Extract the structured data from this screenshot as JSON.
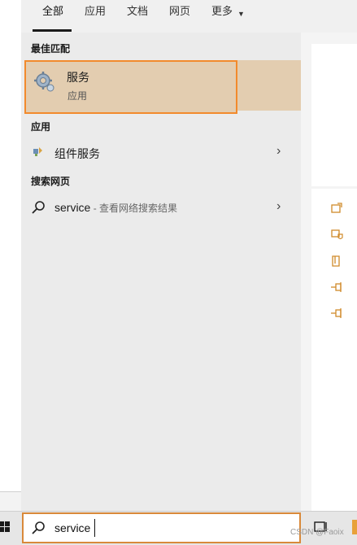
{
  "tabs": [
    {
      "label": "全部",
      "active": true
    },
    {
      "label": "应用"
    },
    {
      "label": "文档"
    },
    {
      "label": "网页"
    },
    {
      "label": "更多"
    }
  ],
  "sections": {
    "best_match": "最佳匹配",
    "apps": "应用",
    "web": "搜索网页"
  },
  "best_match_item": {
    "title": "服务",
    "subtitle": "应用",
    "icon": "services-gear-icon"
  },
  "app_items": [
    {
      "label": "组件服务",
      "icon": "component-services-icon"
    }
  ],
  "web_items": [
    {
      "label": "service",
      "suffix": " - 查看网络搜索结果",
      "icon": "search-icon"
    }
  ],
  "search": {
    "value": "service"
  },
  "watermark": "CSDN @Faoix",
  "colors": {
    "highlight_bg": "#e3cdb0",
    "highlight_border": "#f28a2c",
    "search_border": "#d9893a",
    "panel_bg": "#ebebeb",
    "accent_icon": "#d08a2a"
  }
}
